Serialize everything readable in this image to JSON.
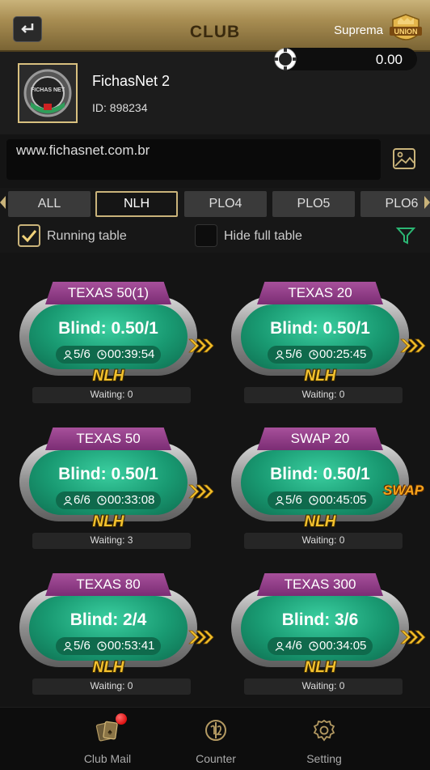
{
  "header": {
    "title": "CLUB",
    "union_name": "Suprema",
    "union_logo_text": "UNION"
  },
  "profile": {
    "club_name": "FichasNet 2",
    "club_id": "ID: 898234",
    "balance": "0.00",
    "avatar_logo_text": "FICHAS NET"
  },
  "notice": {
    "text": "www.fichasnet.com.br"
  },
  "tabs": [
    {
      "label": "ALL",
      "active": false
    },
    {
      "label": "NLH",
      "active": true
    },
    {
      "label": "PLO4",
      "active": false
    },
    {
      "label": "PLO5",
      "active": false
    },
    {
      "label": "PLO6",
      "active": false
    }
  ],
  "filters": {
    "running_label": "Running table",
    "running_checked": true,
    "hide_full_label": "Hide full table",
    "hide_full_checked": false
  },
  "tables": [
    {
      "name": "TEXAS 50(1)",
      "blind": "Blind: 0.50/1",
      "seats": "5/6",
      "time": "00:39:54",
      "game": "NLH",
      "waiting": "Waiting: 0",
      "swap": false
    },
    {
      "name": "TEXAS 20",
      "blind": "Blind: 0.50/1",
      "seats": "5/6",
      "time": "00:25:45",
      "game": "NLH",
      "waiting": "Waiting: 0",
      "swap": false
    },
    {
      "name": "TEXAS 50",
      "blind": "Blind: 0.50/1",
      "seats": "6/6",
      "time": "00:33:08",
      "game": "NLH",
      "waiting": "Waiting: 3",
      "swap": false
    },
    {
      "name": "SWAP 20",
      "blind": "Blind: 0.50/1",
      "seats": "5/6",
      "time": "00:45:05",
      "game": "NLH",
      "waiting": "Waiting: 0",
      "swap": true,
      "swap_label": "SWAP"
    },
    {
      "name": "TEXAS 80",
      "blind": "Blind: 2/4",
      "seats": "5/6",
      "time": "00:53:41",
      "game": "NLH",
      "waiting": "Waiting: 0",
      "swap": false
    },
    {
      "name": "TEXAS 300",
      "blind": "Blind: 3/6",
      "seats": "4/6",
      "time": "00:34:05",
      "game": "NLH",
      "waiting": "Waiting: 0",
      "swap": false
    }
  ],
  "bottom_nav": [
    {
      "label": "Club Mail",
      "icon": "mail-cards-icon",
      "has_notification": true
    },
    {
      "label": "Counter",
      "icon": "counter-icon",
      "has_notification": false
    },
    {
      "label": "Setting",
      "icon": "gear-icon",
      "has_notification": false
    }
  ],
  "colors": {
    "gold": "#c9b37a",
    "felt_green": "#199a72",
    "tag_purple": "#8a3a82",
    "game_yellow": "#f3c12e",
    "filter_green": "#2bb673"
  }
}
